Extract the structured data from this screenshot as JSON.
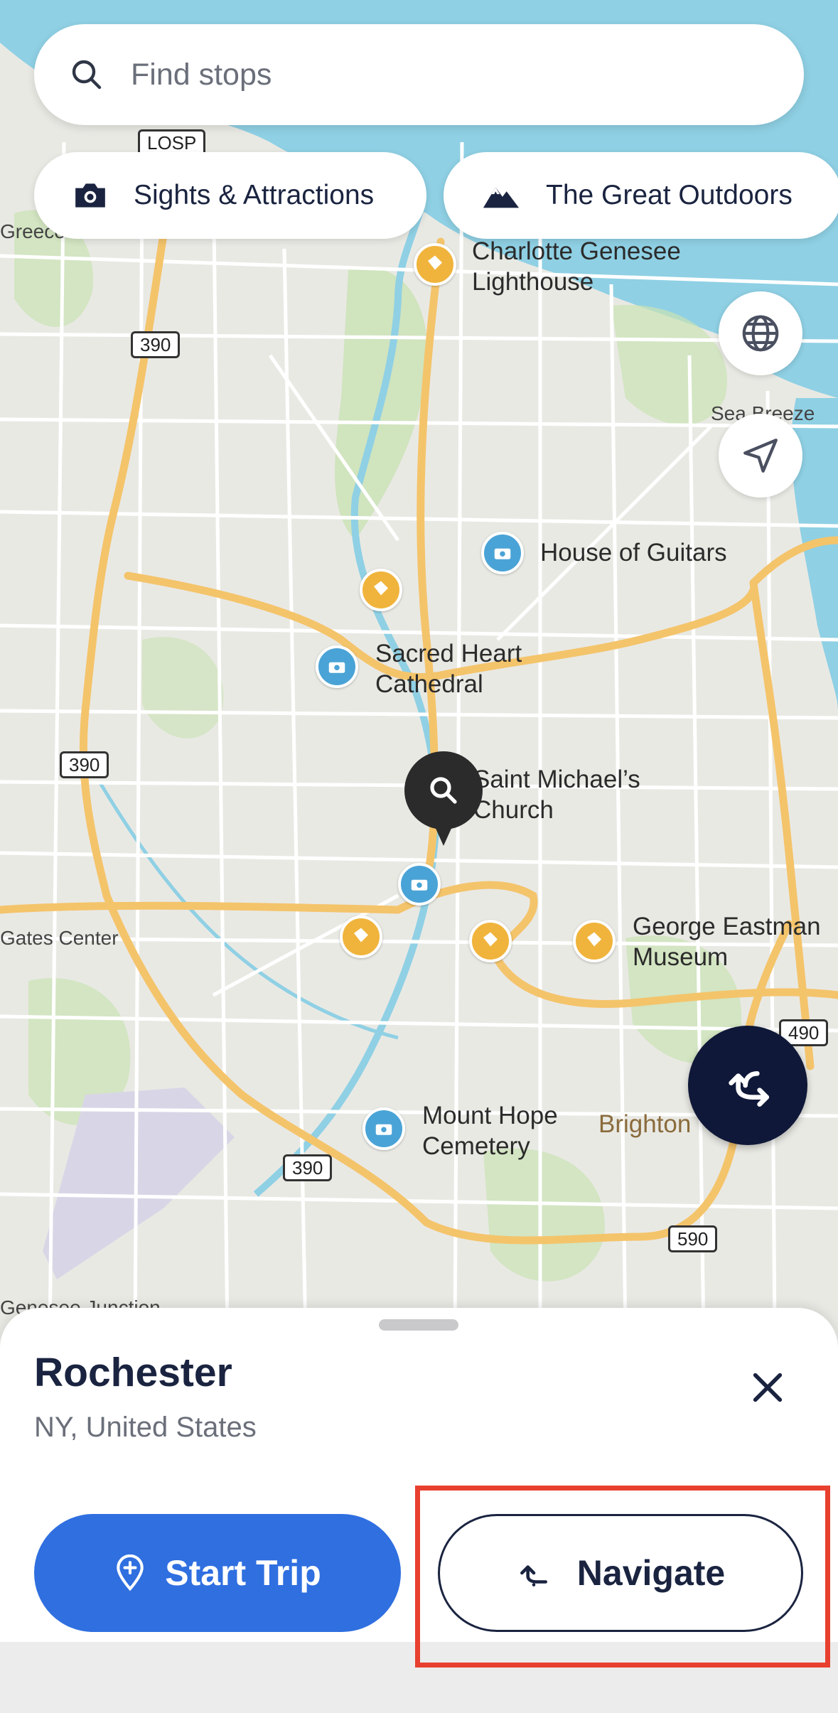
{
  "search": {
    "placeholder": "Find stops",
    "icon": "search-icon"
  },
  "chips": [
    {
      "label": "Sights & Attractions",
      "icon": "camera-icon"
    },
    {
      "label": "The Great Outdoors",
      "icon": "mountain-icon"
    }
  ],
  "map": {
    "labels": {
      "charlotte": "Charlotte Genesee\nLighthouse",
      "guitars": "House of Guitars",
      "sacred": "Sacred Heart\nCathedral",
      "michael": "Saint Michael’s\nChurch",
      "eastman": "George Eastman\nMuseum",
      "hope": "Mount Hope\nCemetery",
      "brighton": "Brighton",
      "seabreeze": "Sea Breeze",
      "gates": "Gates Center",
      "greece": "Greece",
      "genesee": "Genesee Junction",
      "losp": "LOSP"
    },
    "shields": [
      "390",
      "390",
      "390",
      "490",
      "590"
    ],
    "colors": {
      "water": "#8fd0e4",
      "land": "#e9e9e4",
      "park": "#c9e2b4",
      "highway": "#f4c46b",
      "road": "#ffffff"
    }
  },
  "place": {
    "title": "Rochester",
    "subtitle": "NY, United States"
  },
  "actions": {
    "start_label": "Start Trip",
    "navigate_label": "Navigate"
  },
  "colors": {
    "primary": "#2f6fe0",
    "navy": "#1a2440",
    "highlight": "#e8402f"
  }
}
